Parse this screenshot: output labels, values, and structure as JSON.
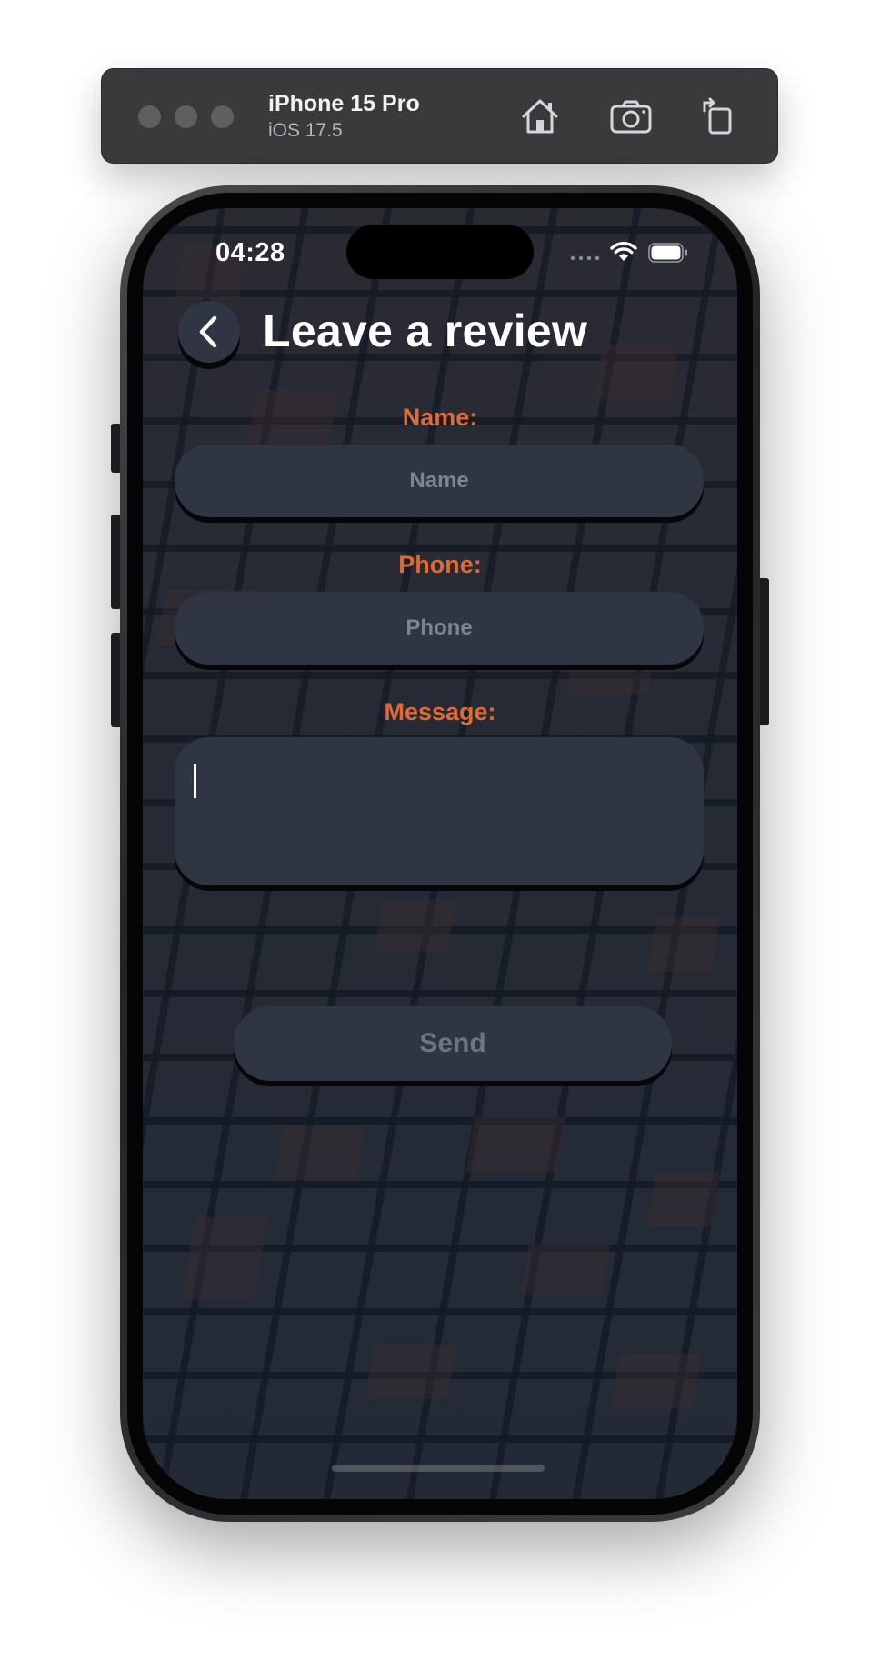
{
  "simulator": {
    "device_name": "iPhone 15 Pro",
    "os_version": "iOS 17.5",
    "buttons": [
      "home-icon",
      "screenshot-icon",
      "rotate-icon"
    ]
  },
  "status_bar": {
    "time": "04:28",
    "icons": [
      "cellular-signal-icon",
      "wifi-icon",
      "battery-icon"
    ]
  },
  "header": {
    "title": "Leave a review",
    "back_icon": "chevron-left-icon"
  },
  "form": {
    "name": {
      "label": "Name:",
      "placeholder": "Name",
      "value": ""
    },
    "phone": {
      "label": "Phone:",
      "placeholder": "Phone",
      "value": ""
    },
    "message": {
      "label": "Message:",
      "value": ""
    },
    "send_label": "Send"
  },
  "colors": {
    "accent": "#e06a32",
    "field_bg": "#2f3543",
    "screen_bg": "#222935",
    "send_text": "#6e7483",
    "placeholder": "#7d8393"
  }
}
